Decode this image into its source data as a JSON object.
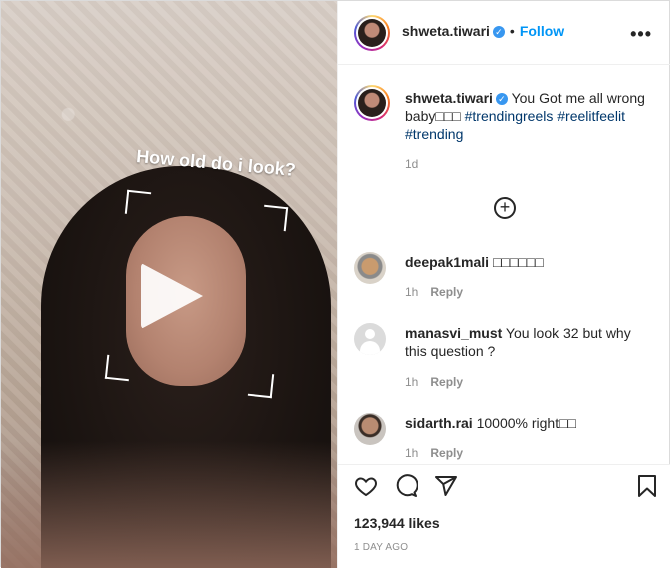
{
  "post": {
    "username": "shweta.tiwari",
    "follow_label": "Follow",
    "dot": "•",
    "more": "•••",
    "verified_mark": "✓"
  },
  "media": {
    "filter_text": "How old do i look?"
  },
  "caption": {
    "username": "shweta.tiwari",
    "text": "You Got me all wrong baby□□□",
    "hashtags": [
      "#trendingreels",
      "#reelitfeelit",
      "#trending"
    ],
    "time": "1d"
  },
  "comments": [
    {
      "username": "deepak1mali",
      "text": "□□□□□□",
      "time": "1h",
      "reply": "Reply"
    },
    {
      "username": "manasvi_must",
      "text": "You look 32 but why this question ?",
      "time": "1h",
      "reply": "Reply"
    },
    {
      "username": "sidarth.rai",
      "text": "10000% right□□",
      "time": "1h",
      "reply": "Reply"
    }
  ],
  "stats": {
    "likes": "123,944 likes",
    "date": "1 DAY AGO"
  },
  "icons": {
    "like": "heart-icon",
    "comment": "comment-icon",
    "share": "share-icon",
    "save": "bookmark-icon",
    "add": "add-comment-icon"
  },
  "colors": {
    "link": "#0095f6",
    "hashtag": "#00376b",
    "verified": "#3897f0",
    "muted": "#8e8e8e"
  }
}
